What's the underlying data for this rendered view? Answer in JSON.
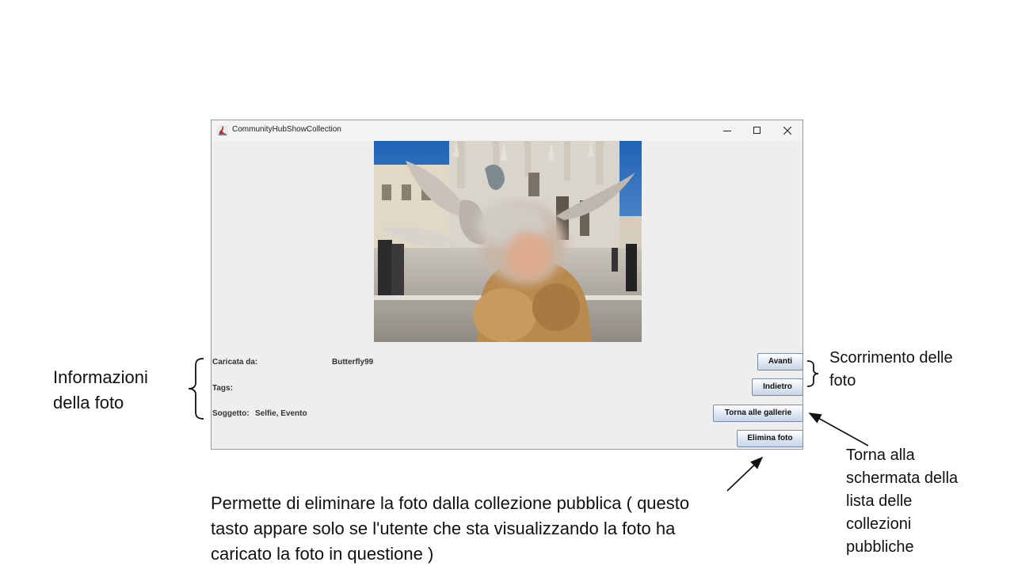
{
  "window": {
    "title": "CommunityHubShowCollection",
    "controls": [
      "minimize",
      "maximize",
      "close"
    ]
  },
  "photo": {
    "subject_icon": "selfie-photo"
  },
  "info": {
    "uploaded_by_label": "Caricata da:",
    "uploaded_by_value": "Butterfly99",
    "tags_label": "Tags:",
    "subject_label": "Soggetto:",
    "subject_value": "Selfie, Evento"
  },
  "buttons": {
    "next": "Avanti",
    "back": "Indietro",
    "galleries": "Torna alle gallerie",
    "delete": "Elimina foto"
  },
  "annotations": {
    "info_line1": "Informazioni",
    "info_line2": "della foto",
    "scroll_line1": "Scorrimento delle",
    "scroll_line2": "foto",
    "back_line1": "Torna alla",
    "back_line2": "schermata della",
    "back_line3": "lista delle",
    "back_line4": "collezioni",
    "back_line5": "pubbliche",
    "delete_line1": "Permette di eliminare la foto dalla collezione pubblica ( questo",
    "delete_line2": "tasto appare solo se l'utente che sta visualizzando la foto ha",
    "delete_line3": "caricato la foto in questione  )"
  },
  "colors": {
    "window_bg": "#eeeeee",
    "button_border": "#7a8aa3",
    "sky": "#2e6fb8"
  }
}
